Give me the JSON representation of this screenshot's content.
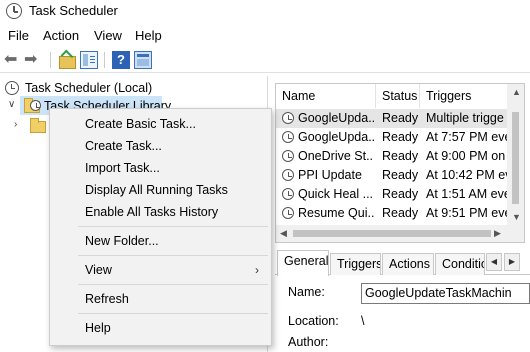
{
  "window": {
    "title": "Task Scheduler"
  },
  "menubar": [
    "File",
    "Action",
    "View",
    "Help"
  ],
  "tree": {
    "root": "Task Scheduler (Local)",
    "library": "Task Scheduler Library"
  },
  "tasklist": {
    "columns": [
      "Name",
      "Status",
      "Triggers"
    ],
    "rows": [
      {
        "name": "GoogleUpda...",
        "status": "Ready",
        "trigger": "Multiple trigge"
      },
      {
        "name": "GoogleUpda...",
        "status": "Ready",
        "trigger": "At 7:57 PM eve"
      },
      {
        "name": "OneDrive St...",
        "status": "Ready",
        "trigger": "At 9:00 PM on"
      },
      {
        "name": "PPI Update",
        "status": "Ready",
        "trigger": "At 10:42 PM ev"
      },
      {
        "name": "Quick Heal ...",
        "status": "Ready",
        "trigger": "At 1:51 AM eve"
      },
      {
        "name": "Resume Qui...",
        "status": "Ready",
        "trigger": "At 9:51 PM eve"
      }
    ]
  },
  "properties": {
    "tabs": [
      "General",
      "Triggers",
      "Actions",
      "Conditio"
    ],
    "name_label": "Name:",
    "name_value": "GoogleUpdateTaskMachin",
    "location_label": "Location:",
    "location_value": "\\",
    "author_label": "Author:"
  },
  "context_menu": {
    "items": [
      "Create Basic Task...",
      "Create Task...",
      "Import Task...",
      "Display All Running Tasks",
      "Enable All Tasks History",
      "New Folder...",
      "View",
      "Refresh",
      "Help"
    ]
  },
  "icons": {
    "toolbar": [
      "back-arrow-icon",
      "forward-arrow-icon",
      "up-folder-icon",
      "show-hide-console-tree-icon",
      "help-icon",
      "show-hide-action-pane-icon"
    ]
  },
  "colors": {
    "selection": "#cce4f7",
    "menu_bg": "#f2f2f2",
    "help_icon": "#2d63b7"
  }
}
